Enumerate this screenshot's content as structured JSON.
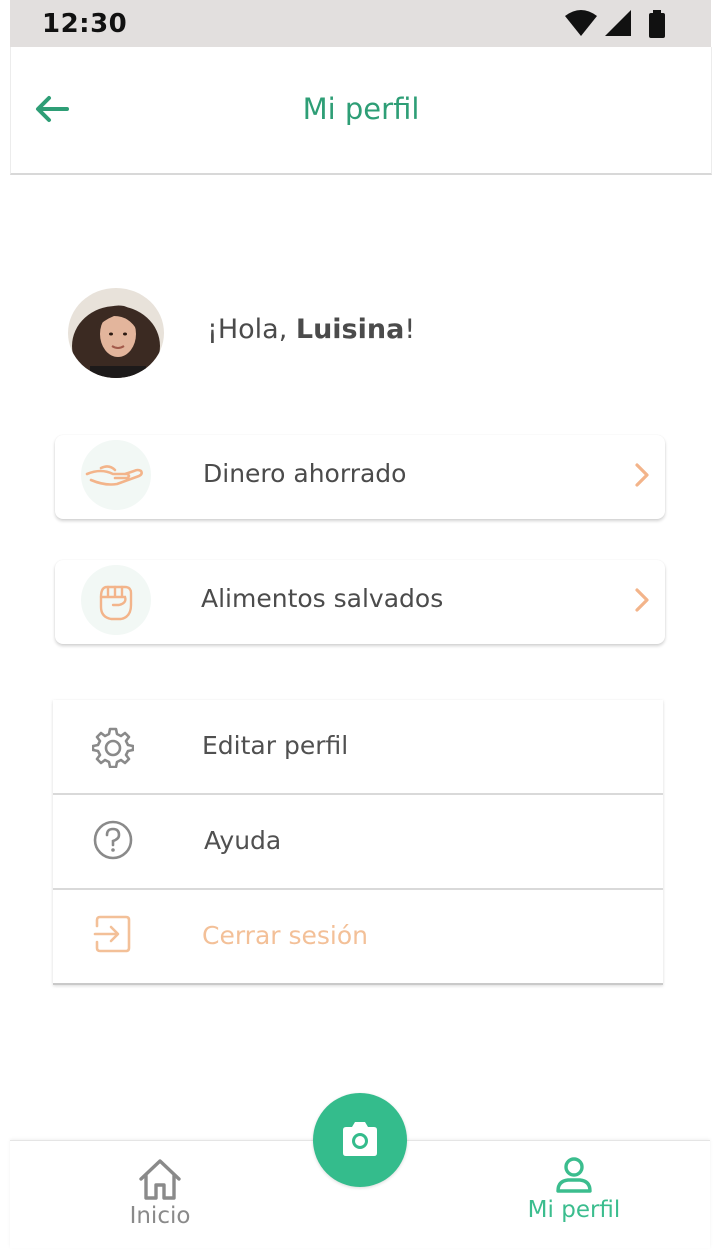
{
  "status_bar": {
    "time": "12:30",
    "icons": [
      "wifi-icon",
      "signal-icon",
      "battery-icon"
    ]
  },
  "header": {
    "title": "Mi perfil",
    "back_icon": "arrow-left-icon"
  },
  "greeting": {
    "prefix": "¡Hola, ",
    "name": "Luisina",
    "suffix": "!"
  },
  "cards": [
    {
      "label": "Dinero ahorrado",
      "icon": "hand-money-icon"
    },
    {
      "label": "Alimentos salvados",
      "icon": "fist-icon"
    }
  ],
  "menu": [
    {
      "label": "Editar perfil",
      "icon": "gear-icon"
    },
    {
      "label": "Ayuda",
      "icon": "help-icon"
    },
    {
      "label": "Cerrar sesión",
      "icon": "logout-icon"
    }
  ],
  "bottom_nav": {
    "home_label": "Inicio",
    "profile_label": "Mi perfil",
    "camera_icon": "camera-icon"
  },
  "colors": {
    "primary": "#2e9e76",
    "accent_green": "#34bc8c",
    "accent_orange": "#f3b48a",
    "text": "#4b4b4b"
  }
}
